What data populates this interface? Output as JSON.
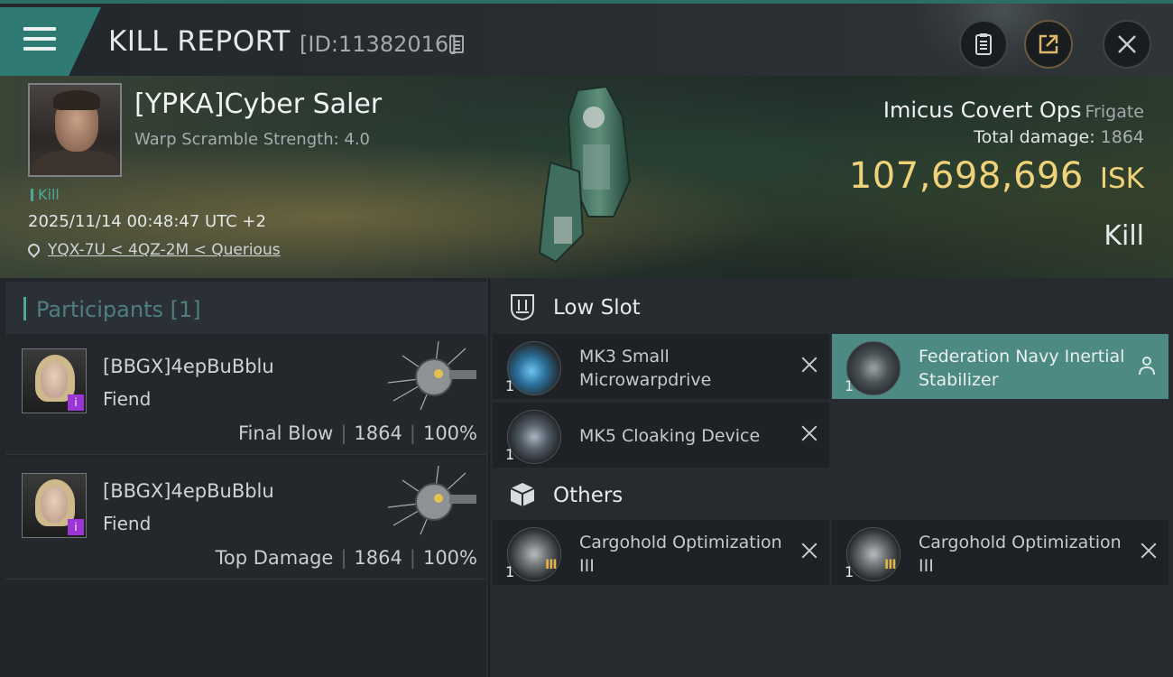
{
  "header": {
    "title": "KILL REPORT",
    "id_label": "[ID:11382016]",
    "buttons": {
      "report": "clipboard-icon",
      "share": "share-icon",
      "close": "close-icon"
    }
  },
  "victim": {
    "name": "[YPKA]Cyber Saler",
    "warp": "Warp Scramble Strength: 4.0",
    "tag": "Kill",
    "datetime": "2025/11/14 00:48:47 UTC +2",
    "location": "YQX-7U < 4QZ-2M < Querious"
  },
  "ship": {
    "name": "Imicus Covert Ops",
    "class": "Frigate",
    "total_damage_label": "Total damage:",
    "total_damage_value": "1864",
    "isk_amount": "107,698,696",
    "isk_unit": "ISK",
    "result": "Kill"
  },
  "participants": {
    "header": "Participants [1]",
    "list": [
      {
        "name": "[BBGX]4epBuBblu",
        "role": "Fiend",
        "tag": "Final Blow",
        "damage": "1864",
        "percent": "100%",
        "badge": "i"
      },
      {
        "name": "[BBGX]4epBuBblu",
        "role": "Fiend",
        "tag": "Top Damage",
        "damage": "1864",
        "percent": "100%",
        "badge": "i"
      }
    ]
  },
  "sections": {
    "low_slot": {
      "title": "Low Slot",
      "items": [
        {
          "name": "MK3 Small Microwarpdrive",
          "qty": "1"
        },
        {
          "name": "Federation Navy Inertial Stabilizer",
          "qty": "1"
        },
        {
          "name": "MK5 Cloaking Device",
          "qty": "1"
        }
      ]
    },
    "others": {
      "title": "Others",
      "items": [
        {
          "name": "Cargohold Optimization III",
          "qty": "1",
          "tier": "III"
        },
        {
          "name": "Cargohold Optimization III",
          "qty": "1",
          "tier": "III"
        }
      ]
    }
  },
  "colors": {
    "accent": "#4fa89e",
    "isk": "#f0d27a",
    "highlight": "#4d8a84",
    "badge": "#9b35d6"
  }
}
